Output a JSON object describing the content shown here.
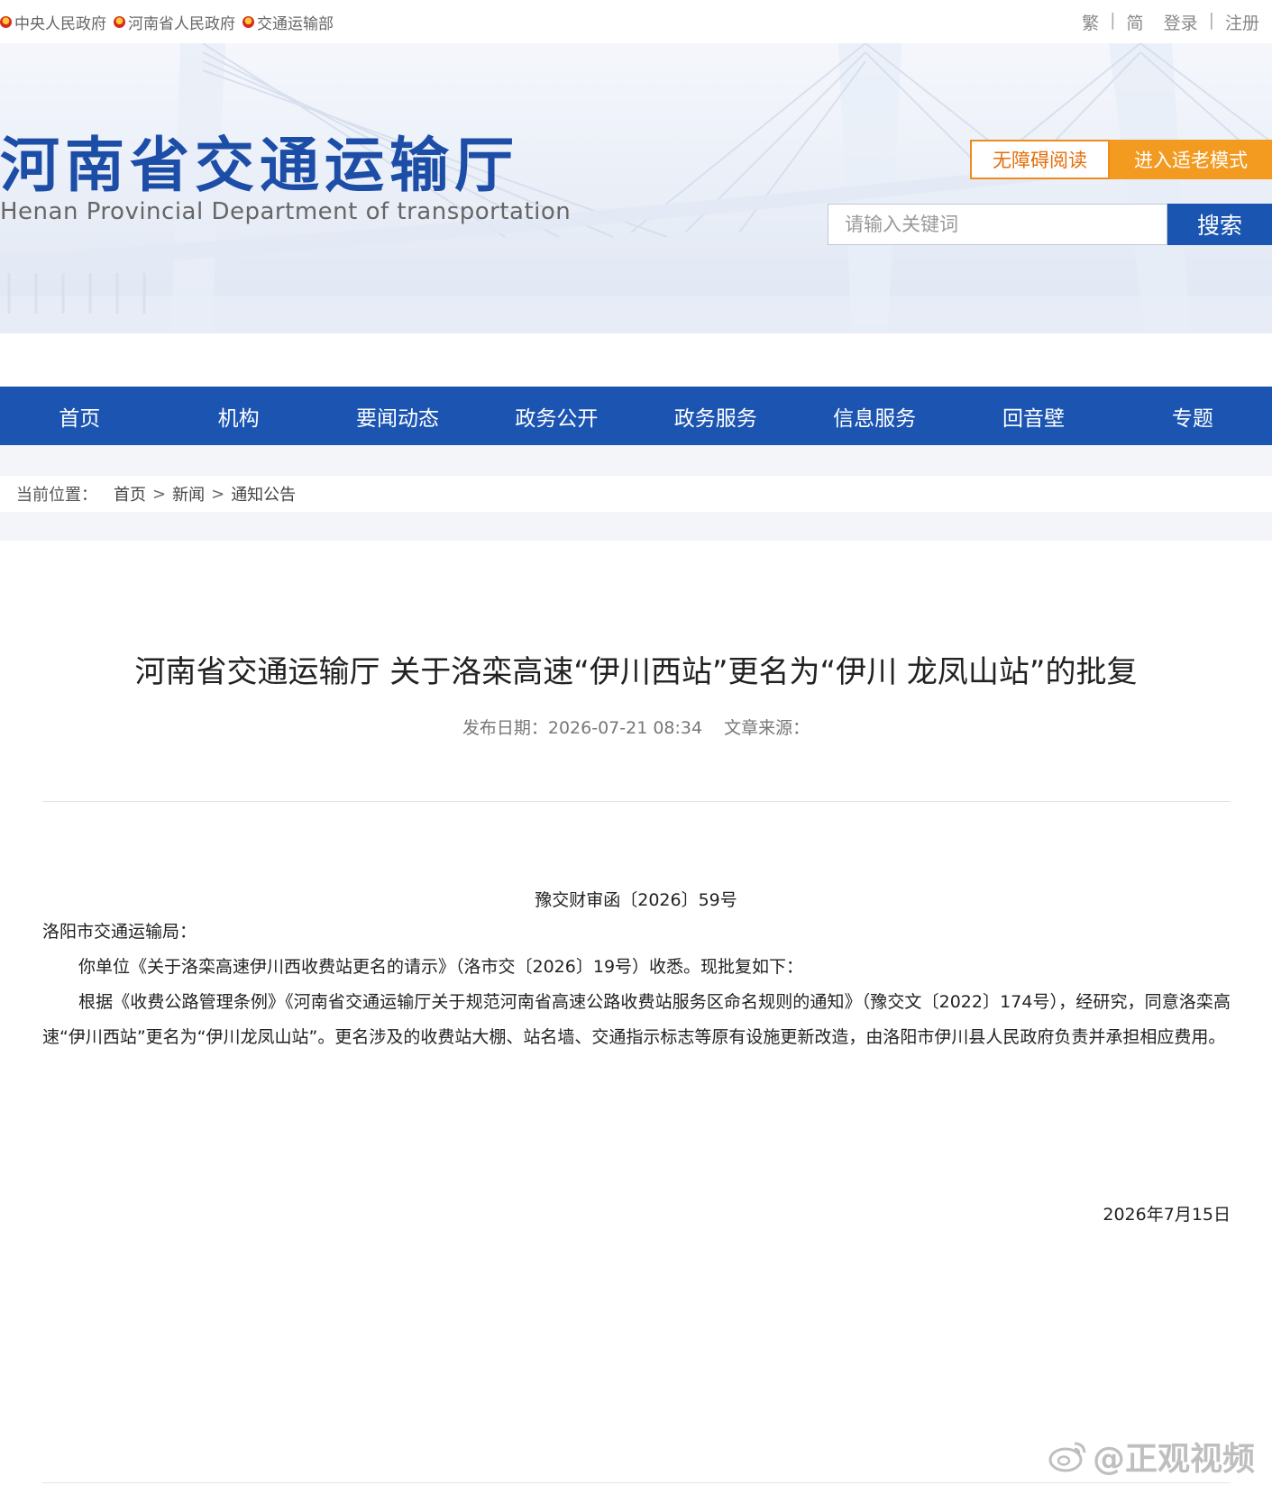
{
  "topbar": {
    "links": [
      {
        "label": "中央人民政府"
      },
      {
        "label": "河南省人民政府"
      },
      {
        "label": "交通运输部"
      }
    ],
    "traditional": "繁",
    "separator": "|",
    "simplified": "简",
    "login": "登录",
    "register": "注册"
  },
  "header": {
    "title": "河南省交通运输厅",
    "subtitle": "Henan Provincial Department of transportation",
    "accessibility_button": "无障碍阅读",
    "elder_mode_button": "进入适老模式",
    "search": {
      "placeholder": "请输入关键词",
      "value": "",
      "button": "搜索"
    }
  },
  "nav": {
    "items": [
      "首页",
      "机构",
      "要闻动态",
      "政务公开",
      "政务服务",
      "信息服务",
      "回音壁",
      "专题"
    ]
  },
  "breadcrumb": {
    "label": "当前位置：",
    "items": [
      "首页",
      "新闻",
      "通知公告"
    ],
    "separator": ">"
  },
  "article": {
    "title": "河南省交通运输厅 关于洛栾高速“伊川西站”更名为“伊川 龙凤山站”的批复",
    "publish_date": "发布日期：2026-07-21 08:34",
    "source": "文章来源：",
    "doc_number": "豫交财审函〔2026〕59号",
    "addressee": "洛阳市交通运输局：",
    "paragraphs": [
      "你单位《关于洛栾高速伊川西收费站更名的请示》（洛市交〔2026〕19号）收悉。现批复如下：",
      "根据《收费公路管理条例》《河南省交通运输厅关于规范河南省高速公路收费站服务区命名规则的通知》（豫交文〔2022〕174号），经研究，同意洛栾高速“伊川西站”更名为“伊川龙凤山站”。更名涉及的收费站大棚、站名墙、交通指示标志等原有设施更新改造，由洛阳市伊川县人民政府负责并承担相应费用。"
    ],
    "date": "2026年7月15日"
  },
  "watermark": "@正观视频",
  "colors": {
    "brand_blue": "#1b54b1",
    "accent_orange": "#f39a21"
  }
}
